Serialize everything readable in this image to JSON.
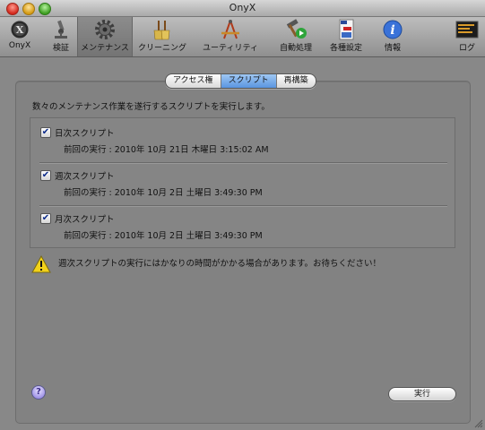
{
  "window": {
    "title": "OnyX"
  },
  "toolbar": {
    "items": [
      {
        "label": "OnyX",
        "icon": "onyx-logo-icon"
      },
      {
        "label": "検証",
        "icon": "microscope-icon"
      },
      {
        "label": "メンテナンス",
        "icon": "gear-icon",
        "selected": true
      },
      {
        "label": "クリーニング",
        "icon": "brooms-icon"
      },
      {
        "label": "ユーティリティ",
        "icon": "compass-ruler-icon"
      },
      {
        "label": "自動処理",
        "icon": "hammer-play-icon"
      },
      {
        "label": "各種設定",
        "icon": "settings-file-icon"
      },
      {
        "label": "情報",
        "icon": "info-icon"
      },
      {
        "label": "ログ",
        "icon": "log-console-icon"
      }
    ]
  },
  "tabs": [
    {
      "label": "アクセス権",
      "active": false
    },
    {
      "label": "スクリプト",
      "active": true
    },
    {
      "label": "再構築",
      "active": false
    }
  ],
  "description": "数々のメンテナンス作業を遂行するスクリプトを実行します。",
  "scripts": [
    {
      "label": "日次スクリプト",
      "checked": true,
      "last_run": "前回の実行 : 2010年 10月 21日 木曜日 3:15:02 AM"
    },
    {
      "label": "週次スクリプト",
      "checked": true,
      "last_run": "前回の実行 : 2010年 10月 2日 土曜日 3:49:30 PM"
    },
    {
      "label": "月次スクリプト",
      "checked": true,
      "last_run": "前回の実行 : 2010年 10月 2日 土曜日 3:49:30 PM"
    }
  ],
  "warning": "週次スクリプトの実行にはかなりの時間がかかる場合があります。お待ちください！",
  "buttons": {
    "help": "?",
    "run": "実行"
  },
  "colors": {
    "accent": "#5a95e0",
    "checkmark": "#0a2a8a",
    "warning": "#f2d21a"
  }
}
